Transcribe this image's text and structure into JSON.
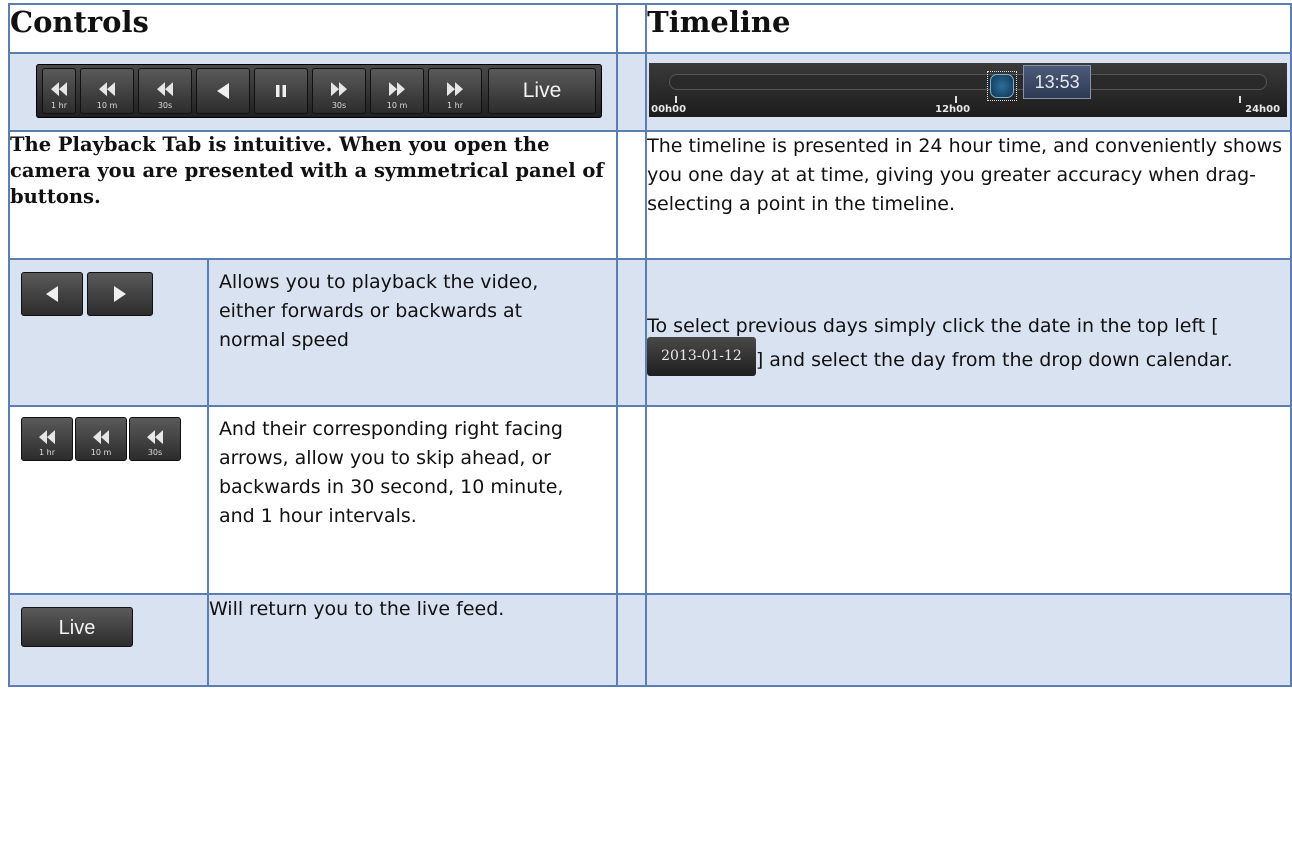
{
  "headers": {
    "controls": "Controls",
    "timeline": "Timeline"
  },
  "controls_bar": {
    "buttons": [
      {
        "icon": "rewind-icon",
        "caption": "1 hr"
      },
      {
        "icon": "rewind-icon",
        "caption": "10 m"
      },
      {
        "icon": "rewind-icon",
        "caption": "30s"
      },
      {
        "icon": "play-reverse-icon",
        "caption": ""
      },
      {
        "icon": "pause-icon",
        "caption": ""
      },
      {
        "icon": "fast-forward-icon",
        "caption": "30s"
      },
      {
        "icon": "fast-forward-icon",
        "caption": "10 m"
      },
      {
        "icon": "fast-forward-icon",
        "caption": "1 hr"
      }
    ],
    "live_label": "Live"
  },
  "timeline_bar": {
    "time": "13:53",
    "ticks": [
      "00h00",
      "12h00",
      "24h00"
    ]
  },
  "intro_text": "The Playback Tab is intuitive. When you open the camera you are presented with a symmetrical panel of buttons.",
  "timeline_text": "The timeline is presented in 24 hour time, and conveniently shows you one day at at time, giving you greater accuracy when drag-selecting a point in the timeline.",
  "play_text": "Allows you to playback the video, either forwards or backwards at normal speed",
  "calendar": {
    "before": "To select previous days simply click the date in the top left [",
    "date": "2013-01-12",
    "after": "] and select the day from the drop down calendar."
  },
  "skip_captions": [
    "1 hr",
    "10 m",
    "30s"
  ],
  "skip_text": "And their corresponding right facing arrows, allow you to skip ahead, or backwards in 30 second, 10 minute, and 1 hour intervals.",
  "live_button_label": "Live",
  "live_text": "Will return you to the live feed.",
  "colors": {
    "table_border": "#5b7fb3",
    "shaded_row": "#d9e2f1",
    "button_dark": "#2c2c2c"
  }
}
